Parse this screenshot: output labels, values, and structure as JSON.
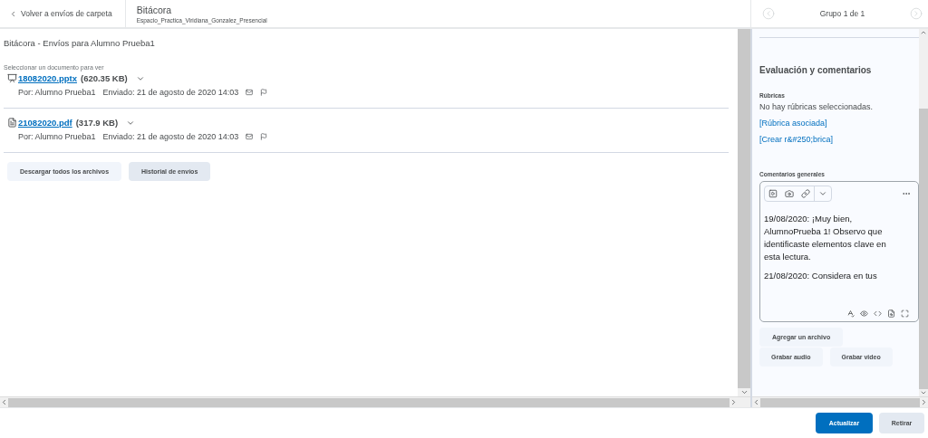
{
  "header": {
    "back_link": "Volver a envíos de carpeta",
    "title": "Bitácora",
    "subtitle": "Espacio_Practica_Viridiana_Gonzalez_Presencial",
    "group_label": "Grupo 1 de 1"
  },
  "submissions": {
    "heading": "Bitácora - Envíos para Alumno Prueba1",
    "select_label": "Seleccionar un documento para ver",
    "files": [
      {
        "kind": "presentation",
        "name": "18082020.pptx",
        "size": "(620.35 KB)",
        "by": "Por: Alumno Prueba1",
        "sent": "Enviado: 21 de agosto de 2020 14:03"
      },
      {
        "kind": "document",
        "name": "21082020.pdf",
        "size": "(317.9 KB)",
        "by": "Por: Alumno Prueba1",
        "sent": "Enviado: 21 de agosto de 2020 14:03"
      }
    ],
    "buttons": [
      {
        "label": "Descargar todos los archivos",
        "selected": false
      },
      {
        "label": "Historial de envíos",
        "selected": true
      }
    ]
  },
  "evaluation": {
    "heading": "Evaluación y comentarios",
    "rubrics_label": "Rúbricas",
    "rubrics_text": "No hay rúbricas seleccionadas.",
    "rubric_links": [
      "[Rúbrica asociada]",
      "[Crear r&#250;brica]"
    ],
    "comments_label": "Comentarios generales",
    "comments": [
      "19/08/2020: ¡Muy bien, AlumnoPrueba 1! Observo que identificaste elementos clave en esta lectura.",
      "21/08/2020: Considera en tus"
    ],
    "buttons": [
      "Agregar un archivo",
      "Grabar audio",
      "Grabar video"
    ]
  },
  "footer": {
    "buttons": [
      {
        "label": "Actualizar",
        "primary": true
      },
      {
        "label": "Retirar",
        "primary": false
      }
    ]
  }
}
